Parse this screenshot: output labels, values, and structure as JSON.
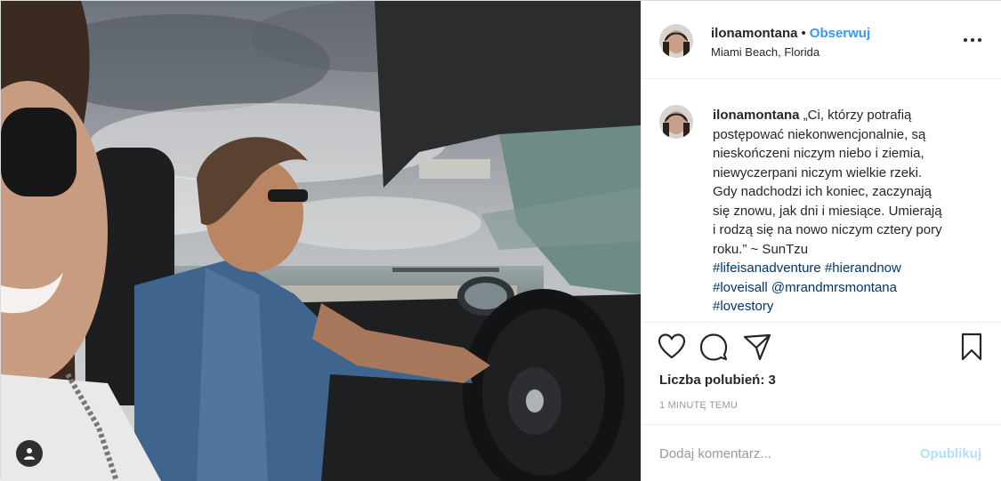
{
  "post": {
    "username": "ilonamontana",
    "separator": "•",
    "follow_label": "Obserwuj",
    "location": "Miami Beach, Florida",
    "caption_text": "„Ci, którzy potrafią postępować niekonwencjonalnie, są nieskończeni niczym niebo i ziemia, niewyczerpani niczym wielkie rzeki. Gdy nadchodzi ich koniec, zaczynają się znowu, jak dni i miesiące. Umierają i rodzą się na nowo niczym cztery pory roku.” ~ SunTzu",
    "hashtags": [
      "#lifeisanadventure",
      "#hierandnow",
      "#loveisall",
      "@mrandmrsmontana",
      "#lovestory"
    ],
    "likes_text": "Liczba polubień: 3",
    "timestamp": "1 minutę temu",
    "comment_placeholder": "Dodaj komentarz...",
    "publish_label": "Opublikuj"
  },
  "icons": {
    "like": "heart-icon",
    "comment": "comment-icon",
    "share": "share-icon",
    "save": "bookmark-icon",
    "more": "more-options-icon",
    "user_tag": "user-tag-icon"
  },
  "colors": {
    "link_blue": "#3897f0",
    "hashtag": "#003569",
    "publish_disabled": "#b2dffc",
    "text": "#262626",
    "muted": "#999999"
  }
}
